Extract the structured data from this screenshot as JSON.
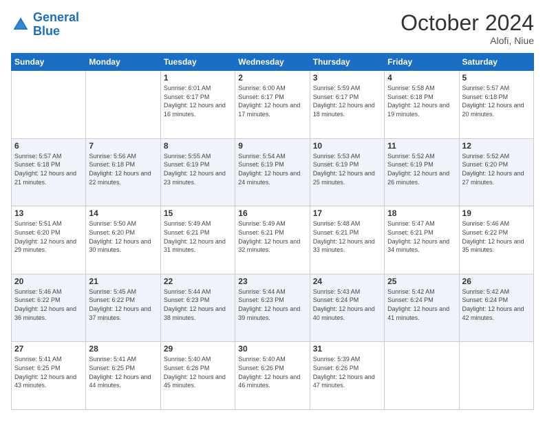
{
  "header": {
    "logo_line1": "General",
    "logo_line2": "Blue",
    "month": "October 2024",
    "location": "Alofi, Niue"
  },
  "days_of_week": [
    "Sunday",
    "Monday",
    "Tuesday",
    "Wednesday",
    "Thursday",
    "Friday",
    "Saturday"
  ],
  "weeks": [
    [
      {
        "day": "",
        "info": ""
      },
      {
        "day": "",
        "info": ""
      },
      {
        "day": "1",
        "info": "Sunrise: 6:01 AM\nSunset: 6:17 PM\nDaylight: 12 hours and 16 minutes."
      },
      {
        "day": "2",
        "info": "Sunrise: 6:00 AM\nSunset: 6:17 PM\nDaylight: 12 hours and 17 minutes."
      },
      {
        "day": "3",
        "info": "Sunrise: 5:59 AM\nSunset: 6:17 PM\nDaylight: 12 hours and 18 minutes."
      },
      {
        "day": "4",
        "info": "Sunrise: 5:58 AM\nSunset: 6:18 PM\nDaylight: 12 hours and 19 minutes."
      },
      {
        "day": "5",
        "info": "Sunrise: 5:57 AM\nSunset: 6:18 PM\nDaylight: 12 hours and 20 minutes."
      }
    ],
    [
      {
        "day": "6",
        "info": "Sunrise: 5:57 AM\nSunset: 6:18 PM\nDaylight: 12 hours and 21 minutes."
      },
      {
        "day": "7",
        "info": "Sunrise: 5:56 AM\nSunset: 6:18 PM\nDaylight: 12 hours and 22 minutes."
      },
      {
        "day": "8",
        "info": "Sunrise: 5:55 AM\nSunset: 6:19 PM\nDaylight: 12 hours and 23 minutes."
      },
      {
        "day": "9",
        "info": "Sunrise: 5:54 AM\nSunset: 6:19 PM\nDaylight: 12 hours and 24 minutes."
      },
      {
        "day": "10",
        "info": "Sunrise: 5:53 AM\nSunset: 6:19 PM\nDaylight: 12 hours and 25 minutes."
      },
      {
        "day": "11",
        "info": "Sunrise: 5:52 AM\nSunset: 6:19 PM\nDaylight: 12 hours and 26 minutes."
      },
      {
        "day": "12",
        "info": "Sunrise: 5:52 AM\nSunset: 6:20 PM\nDaylight: 12 hours and 27 minutes."
      }
    ],
    [
      {
        "day": "13",
        "info": "Sunrise: 5:51 AM\nSunset: 6:20 PM\nDaylight: 12 hours and 29 minutes."
      },
      {
        "day": "14",
        "info": "Sunrise: 5:50 AM\nSunset: 6:20 PM\nDaylight: 12 hours and 30 minutes."
      },
      {
        "day": "15",
        "info": "Sunrise: 5:49 AM\nSunset: 6:21 PM\nDaylight: 12 hours and 31 minutes."
      },
      {
        "day": "16",
        "info": "Sunrise: 5:49 AM\nSunset: 6:21 PM\nDaylight: 12 hours and 32 minutes."
      },
      {
        "day": "17",
        "info": "Sunrise: 5:48 AM\nSunset: 6:21 PM\nDaylight: 12 hours and 33 minutes."
      },
      {
        "day": "18",
        "info": "Sunrise: 5:47 AM\nSunset: 6:21 PM\nDaylight: 12 hours and 34 minutes."
      },
      {
        "day": "19",
        "info": "Sunrise: 5:46 AM\nSunset: 6:22 PM\nDaylight: 12 hours and 35 minutes."
      }
    ],
    [
      {
        "day": "20",
        "info": "Sunrise: 5:46 AM\nSunset: 6:22 PM\nDaylight: 12 hours and 36 minutes."
      },
      {
        "day": "21",
        "info": "Sunrise: 5:45 AM\nSunset: 6:22 PM\nDaylight: 12 hours and 37 minutes."
      },
      {
        "day": "22",
        "info": "Sunrise: 5:44 AM\nSunset: 6:23 PM\nDaylight: 12 hours and 38 minutes."
      },
      {
        "day": "23",
        "info": "Sunrise: 5:44 AM\nSunset: 6:23 PM\nDaylight: 12 hours and 39 minutes."
      },
      {
        "day": "24",
        "info": "Sunrise: 5:43 AM\nSunset: 6:24 PM\nDaylight: 12 hours and 40 minutes."
      },
      {
        "day": "25",
        "info": "Sunrise: 5:42 AM\nSunset: 6:24 PM\nDaylight: 12 hours and 41 minutes."
      },
      {
        "day": "26",
        "info": "Sunrise: 5:42 AM\nSunset: 6:24 PM\nDaylight: 12 hours and 42 minutes."
      }
    ],
    [
      {
        "day": "27",
        "info": "Sunrise: 5:41 AM\nSunset: 6:25 PM\nDaylight: 12 hours and 43 minutes."
      },
      {
        "day": "28",
        "info": "Sunrise: 5:41 AM\nSunset: 6:25 PM\nDaylight: 12 hours and 44 minutes."
      },
      {
        "day": "29",
        "info": "Sunrise: 5:40 AM\nSunset: 6:26 PM\nDaylight: 12 hours and 45 minutes."
      },
      {
        "day": "30",
        "info": "Sunrise: 5:40 AM\nSunset: 6:26 PM\nDaylight: 12 hours and 46 minutes."
      },
      {
        "day": "31",
        "info": "Sunrise: 5:39 AM\nSunset: 6:26 PM\nDaylight: 12 hours and 47 minutes."
      },
      {
        "day": "",
        "info": ""
      },
      {
        "day": "",
        "info": ""
      }
    ]
  ]
}
